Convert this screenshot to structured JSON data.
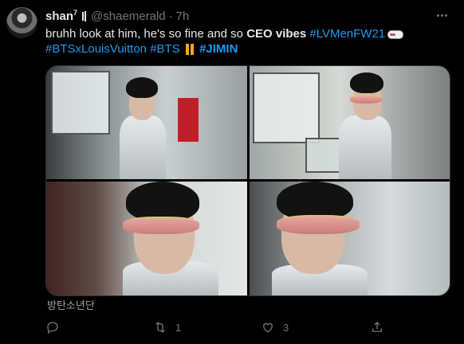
{
  "tweet": {
    "display_name": "shan",
    "name_superscript": "7",
    "handle": "@shaemerald",
    "separator": "·",
    "time": "7h",
    "text": {
      "line1_prefix": "bruhh look at him, he's so fine and so ",
      "line1_bold": "CEO vibes",
      "line1_hashtag": "#LVMenFW21",
      "line2_hashtag1": "#BTSxLouisVuitton",
      "line2_hashtag2": "#BTS",
      "line2_hashtag3": "#JIMIN"
    },
    "media_caption": "방탄소년단",
    "actions": {
      "retweets": "1",
      "likes": "3"
    }
  },
  "icons": {
    "more": "more-horizontal-icon",
    "reply": "reply-icon",
    "retweet": "retweet-icon",
    "like": "heart-icon",
    "share": "share-icon"
  },
  "colors": {
    "background": "#000000",
    "text": "#e7e9ea",
    "muted": "#71767b",
    "link": "#1d9bf0",
    "border": "#2f3336"
  }
}
